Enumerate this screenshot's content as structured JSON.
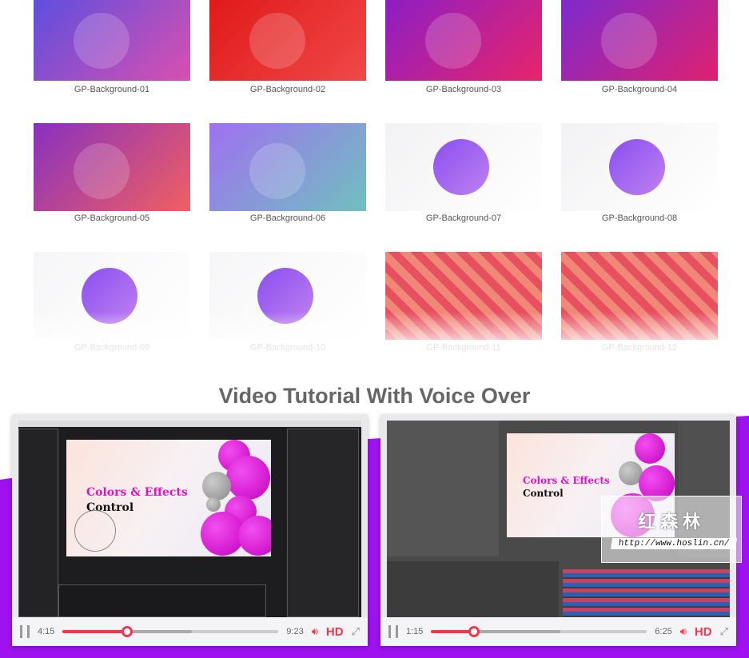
{
  "gallery": [
    {
      "label": "GP-Background-01",
      "colors": [
        "#5a4fe0",
        "#d94fb0"
      ]
    },
    {
      "label": "GP-Background-02",
      "colors": [
        "#e01818",
        "#f04848"
      ]
    },
    {
      "label": "GP-Background-03",
      "colors": [
        "#8a1ec8",
        "#e8246a"
      ]
    },
    {
      "label": "GP-Background-04",
      "colors": [
        "#7a2ad0",
        "#e02070"
      ]
    },
    {
      "label": "GP-Background-05",
      "colors": [
        "#8830c0",
        "#f06060"
      ]
    },
    {
      "label": "GP-Background-06",
      "colors": [
        "#a070f0",
        "#70c0c0"
      ]
    },
    {
      "label": "GP-Background-07",
      "colors": [
        "#f2f2f4",
        "#ffffff"
      ]
    },
    {
      "label": "GP-Background-08",
      "colors": [
        "#f2f2f4",
        "#ffffff"
      ]
    },
    {
      "label": "GP-Background-09",
      "colors": [
        "#f6f6f8",
        "#ffffff"
      ]
    },
    {
      "label": "GP-Background-10",
      "colors": [
        "#f6f6f8",
        "#ffffff"
      ]
    },
    {
      "label": "GP-Background-11",
      "colors": [
        "#e85060",
        "#f08878"
      ]
    },
    {
      "label": "GP-Background-12",
      "colors": [
        "#e85060",
        "#f08878"
      ]
    }
  ],
  "section_title": "Video Tutorial With Voice Over",
  "videos": [
    {
      "line1": "Colors & Effects",
      "line2": "Control",
      "current": "4:15",
      "duration": "9:23",
      "progress": 0.3,
      "buffered": 0.6,
      "hd": "HD"
    },
    {
      "line1": "Colors & Effects",
      "line2": "Control",
      "current": "1:15",
      "duration": "6:25",
      "progress": 0.2,
      "buffered": 0.6,
      "hd": "HD"
    }
  ],
  "watermark": {
    "name": "红森林",
    "url": "http://www.hoslin.cn/"
  },
  "accent": "#f0384c"
}
